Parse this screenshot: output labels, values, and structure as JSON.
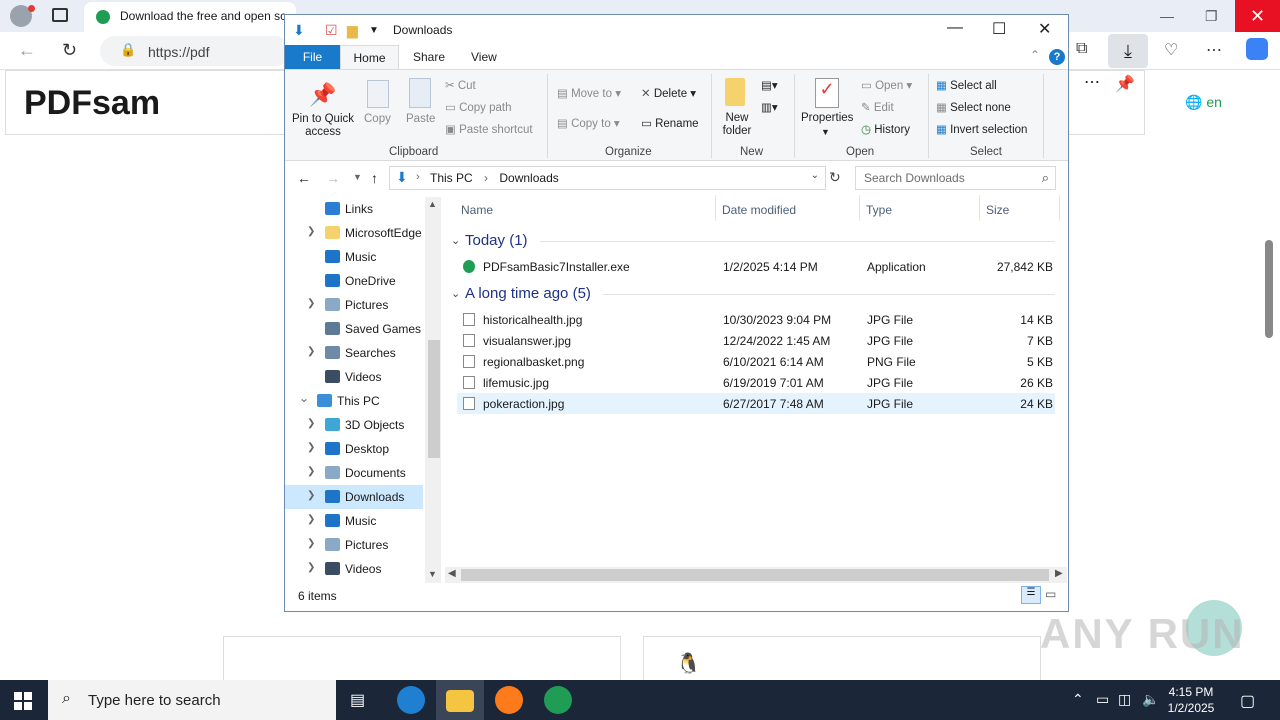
{
  "browser": {
    "tab_title": "Download the free and open sc",
    "url": "https://pdf",
    "lang": "en",
    "site_logo": "PDFsam",
    "watermark": "ANY RUN"
  },
  "explorer": {
    "title": "Downloads",
    "ribbon_tabs": {
      "file": "File",
      "home": "Home",
      "share": "Share",
      "view": "View"
    },
    "clipboard": {
      "pin": "Pin to Quick access",
      "copy": "Copy",
      "paste": "Paste",
      "cut": "Cut",
      "copy_path": "Copy path",
      "paste_shortcut": "Paste shortcut",
      "group": "Clipboard"
    },
    "organize": {
      "move_to": "Move to",
      "copy_to": "Copy to",
      "delete": "Delete",
      "rename": "Rename",
      "group": "Organize"
    },
    "new": {
      "new_folder": "New folder",
      "group": "New"
    },
    "open": {
      "properties": "Properties",
      "open": "Open",
      "edit": "Edit",
      "history": "History",
      "group": "Open"
    },
    "select": {
      "select_all": "Select all",
      "select_none": "Select none",
      "invert": "Invert selection",
      "group": "Select"
    },
    "address": {
      "this_pc": "This PC",
      "downloads": "Downloads"
    },
    "search_placeholder": "Search Downloads",
    "nav": [
      {
        "label": "Links",
        "chev": "",
        "color": "#2a7fd4"
      },
      {
        "label": "MicrosoftEdge",
        "chev": ">",
        "color": "#f5d26b"
      },
      {
        "label": "Music",
        "chev": "",
        "color": "#1e74c8"
      },
      {
        "label": "OneDrive",
        "chev": "",
        "color": "#1e74c8"
      },
      {
        "label": "Pictures",
        "chev": ">",
        "color": "#8aa9c6"
      },
      {
        "label": "Saved Games",
        "chev": "",
        "color": "#5d7a96"
      },
      {
        "label": "Searches",
        "chev": ">",
        "color": "#6e8aa6"
      },
      {
        "label": "Videos",
        "chev": "",
        "color": "#3b4d63"
      },
      {
        "label": "This PC",
        "chev": "v",
        "color": "#3a8fd9"
      },
      {
        "label": "3D Objects",
        "chev": ">",
        "color": "#3fa7d6"
      },
      {
        "label": "Desktop",
        "chev": ">",
        "color": "#1e74c8"
      },
      {
        "label": "Documents",
        "chev": ">",
        "color": "#8aa9c6"
      },
      {
        "label": "Downloads",
        "chev": ">",
        "color": "#1e74c8"
      },
      {
        "label": "Music",
        "chev": ">",
        "color": "#1e74c8"
      },
      {
        "label": "Pictures",
        "chev": ">",
        "color": "#8aa9c6"
      },
      {
        "label": "Videos",
        "chev": ">",
        "color": "#3b4d63"
      }
    ],
    "columns": {
      "name": "Name",
      "date": "Date modified",
      "type": "Type",
      "size": "Size"
    },
    "groups": {
      "today": "Today (1)",
      "longago": "A long time ago (5)"
    },
    "files": [
      {
        "name": "PDFsamBasic7Installer.exe",
        "date": "1/2/2025 4:14 PM",
        "type": "Application",
        "size": "27,842 KB"
      },
      {
        "name": "historicalhealth.jpg",
        "date": "10/30/2023 9:04 PM",
        "type": "JPG File",
        "size": "14 KB"
      },
      {
        "name": "visualanswer.jpg",
        "date": "12/24/2022 1:45 AM",
        "type": "JPG File",
        "size": "7 KB"
      },
      {
        "name": "regionalbasket.png",
        "date": "6/10/2021 6:14 AM",
        "type": "PNG File",
        "size": "5 KB"
      },
      {
        "name": "lifemusic.jpg",
        "date": "6/19/2019 7:01 AM",
        "type": "JPG File",
        "size": "26 KB"
      },
      {
        "name": "pokeraction.jpg",
        "date": "6/27/2017 7:48 AM",
        "type": "JPG File",
        "size": "24 KB"
      }
    ],
    "status": "6 items"
  },
  "taskbar": {
    "search_placeholder": "Type here to search",
    "time": "4:15 PM",
    "date": "1/2/2025"
  }
}
